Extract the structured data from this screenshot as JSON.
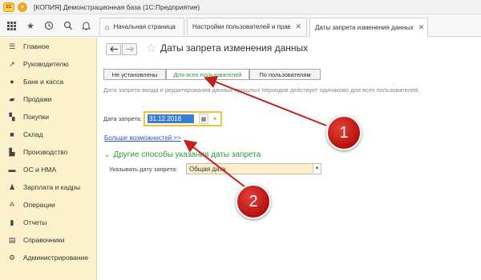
{
  "window": {
    "logo": "1С",
    "title": "[КОПИЯ] Демонстрационная база  (1С:Предприятие)"
  },
  "toolbar": {
    "icons": [
      "grid-icon",
      "star-icon",
      "history-icon",
      "search-icon",
      "bell-icon"
    ]
  },
  "tabs": [
    {
      "label": "Начальная страница",
      "active": false
    },
    {
      "label": "Настройки пользователей и прав",
      "active": false,
      "close": "✕"
    },
    {
      "label": "Даты запрета изменения данных",
      "active": true,
      "close": "✕"
    }
  ],
  "sidebar": {
    "items": [
      {
        "label": "Главное",
        "icon": "menu-icon"
      },
      {
        "label": "Руководителю",
        "icon": "chart-icon"
      },
      {
        "label": "Банк и касса",
        "icon": "coin-icon"
      },
      {
        "label": "Продажи",
        "icon": "bag-icon"
      },
      {
        "label": "Покупки",
        "icon": "cart-icon"
      },
      {
        "label": "Склад",
        "icon": "box-icon"
      },
      {
        "label": "Производство",
        "icon": "factory-icon"
      },
      {
        "label": "ОС и НМА",
        "icon": "truck-icon"
      },
      {
        "label": "Зарплата и кадры",
        "icon": "person-icon"
      },
      {
        "label": "Операции",
        "icon": "operations-icon"
      },
      {
        "label": "Отчеты",
        "icon": "report-icon"
      },
      {
        "label": "Справочники",
        "icon": "book-icon"
      },
      {
        "label": "Администрирование",
        "icon": "gear-icon"
      }
    ]
  },
  "page": {
    "title": "Даты запрета изменения данных",
    "segments": [
      {
        "label": "Не установлены",
        "active": false
      },
      {
        "label": "Для всех пользователей",
        "active": true
      },
      {
        "label": "По пользователям",
        "active": false
      }
    ],
    "description": "Дата запрета ввода и редактирования данных прошлых периодов действует одинаково для всех пользователей.",
    "date_label": "Дата запрета:",
    "date_value": "31.12.2018",
    "more_link": "Больше возможностей >>",
    "other_header": "Другие способы указания даты запрета",
    "spec_label": "Указывать дату запрета:",
    "spec_value": "Общая дата"
  },
  "callouts": [
    "1",
    "2"
  ],
  "colors": {
    "sidebar_bg": "#fbf2cc",
    "accent_green": "#2e9a3f",
    "link_blue": "#2a57b8",
    "highlight_yellow": "#f1c232",
    "callout_red": "#c4211c"
  }
}
